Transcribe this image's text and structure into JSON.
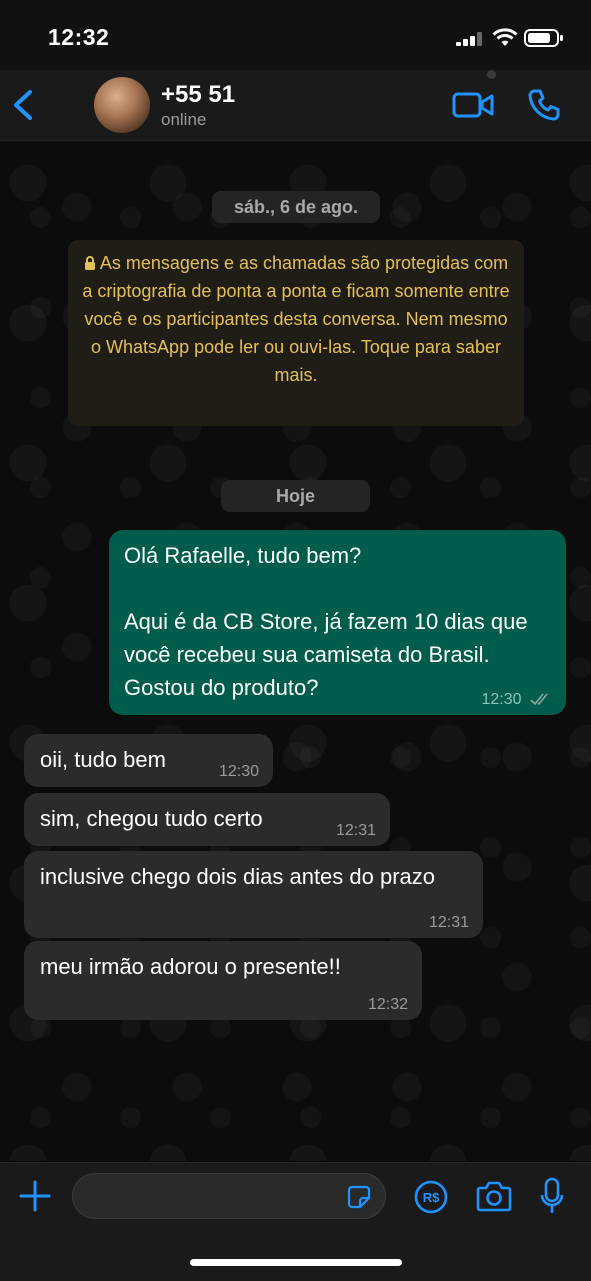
{
  "status_bar": {
    "time": "12:32"
  },
  "header": {
    "contact_name": "+55 51",
    "contact_status": "online",
    "icons": {
      "back": "chevron-left-icon",
      "video": "video-camera-icon",
      "call": "phone-icon"
    }
  },
  "chat": {
    "date_chip": "sáb., 6 de ago.",
    "encryption_notice": "As mensagens e as chamadas são protegidas com a criptografia de ponta a ponta e ficam somente entre você e os participantes desta conversa. Nem mesmo o WhatsApp pode ler ou ouvi-las. Toque para saber mais.",
    "today_chip": "Hoje",
    "messages": [
      {
        "direction": "outgoing",
        "text": "Olá Rafaelle, tudo bem?\n\nAqui é da CB Store, já fazem 10 dias que você recebeu sua camiseta do Brasil. Gostou do produto?",
        "time": "12:30",
        "status": "delivered"
      },
      {
        "direction": "incoming",
        "text": "oii, tudo bem",
        "time": "12:30"
      },
      {
        "direction": "incoming",
        "text": "sim, chegou tudo certo",
        "time": "12:31"
      },
      {
        "direction": "incoming",
        "text": "inclusive chego dois dias antes do prazo",
        "time": "12:31"
      },
      {
        "direction": "incoming",
        "text": "meu irmão adorou o presente!!",
        "time": "12:32"
      }
    ]
  },
  "input_bar": {
    "placeholder": "",
    "icons": {
      "attach": "plus-icon",
      "sticker": "sticker-icon",
      "payment": "payment-icon",
      "camera": "camera-icon",
      "mic": "microphone-icon"
    }
  },
  "colors": {
    "accent": "#1f93ff",
    "outgoing_bubble": "#005c4b",
    "incoming_bubble": "#2b2b2d",
    "notice_text": "#e4c05a"
  }
}
